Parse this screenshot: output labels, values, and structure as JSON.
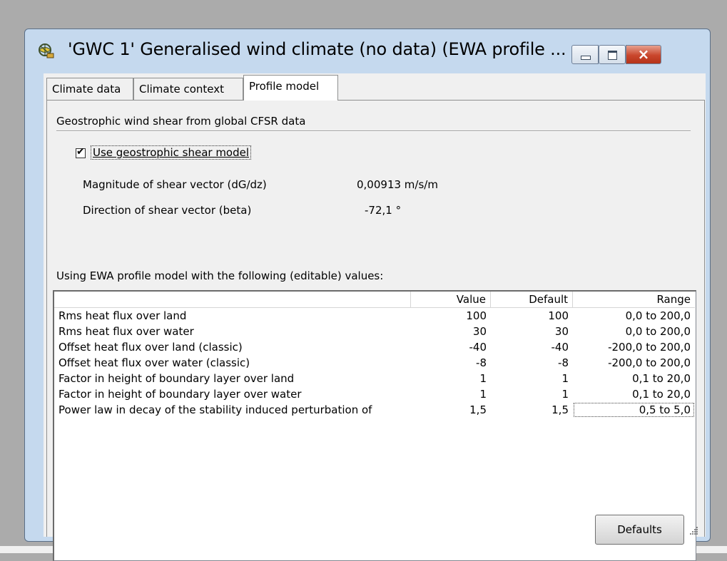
{
  "window": {
    "title": "'GWC 1' Generalised wind climate (no data)  (EWA profile ...",
    "controls": {
      "minimize": "minimize",
      "maximize": "maximize",
      "close": "×"
    }
  },
  "tabs": [
    {
      "label": "Climate data",
      "selected": false
    },
    {
      "label": "Climate context",
      "selected": false
    },
    {
      "label": "Profile model",
      "selected": true
    }
  ],
  "profile_model": {
    "group_title": "Geostrophic wind shear from global CFSR data",
    "use_shear_model": {
      "label": "Use geostrophic shear model",
      "checked": true,
      "mark": "✔"
    },
    "magnitude": {
      "label": "Magnitude of shear vector (dG/dz)",
      "value": "0,00913 m/s/m"
    },
    "direction": {
      "label": "Direction of shear vector (beta)",
      "value": "-72,1 °"
    },
    "list_caption": "Using EWA profile model with the following (editable) values:",
    "columns": {
      "name": "",
      "value": "Value",
      "default": "Default",
      "range": "Range"
    },
    "rows": [
      {
        "name": "Rms heat flux over land",
        "value": "100",
        "default": "100",
        "range": "0,0 to 200,0"
      },
      {
        "name": "Rms heat flux over water",
        "value": "30",
        "default": "30",
        "range": "0,0 to 200,0"
      },
      {
        "name": "Offset heat flux over land (classic)",
        "value": "-40",
        "default": "-40",
        "range": "-200,0 to 200,0"
      },
      {
        "name": "Offset heat flux over water (classic)",
        "value": "-8",
        "default": "-8",
        "range": "-200,0 to 200,0"
      },
      {
        "name": "Factor in height of boundary layer over land",
        "value": "1",
        "default": "1",
        "range": "0,1 to 20,0"
      },
      {
        "name": "Factor in height of boundary layer over water",
        "value": "1",
        "default": "1",
        "range": "0,1 to 20,0"
      },
      {
        "name": "Power law in decay of the stability induced perturbation of",
        "value": "1,5",
        "default": "1,5",
        "range": "0,5 to 5,0"
      }
    ],
    "defaults_button": "Defaults"
  }
}
